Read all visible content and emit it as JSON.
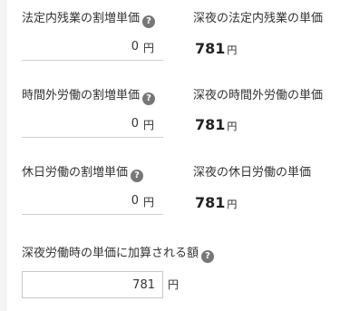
{
  "rows": [
    {
      "label": "法定内残業の割増単価",
      "value": "0",
      "unit": "円",
      "right_label": "深夜の法定内残業の単価",
      "right_value": "781",
      "right_unit": "円"
    },
    {
      "label": "時間外労働の割増単価",
      "value": "0",
      "unit": "円",
      "right_label": "深夜の時間外労働の単価",
      "right_value": "781",
      "right_unit": "円"
    },
    {
      "label": "休日労働の割増単価",
      "value": "0",
      "unit": "円",
      "right_label": "深夜の休日労働の単価",
      "right_value": "781",
      "right_unit": "円"
    }
  ],
  "night_addition": {
    "label": "深夜労働時の単価に加算される額",
    "value": "781",
    "unit": "円"
  },
  "help_glyph": "?",
  "icons": {
    "help": "question-circle-icon"
  }
}
